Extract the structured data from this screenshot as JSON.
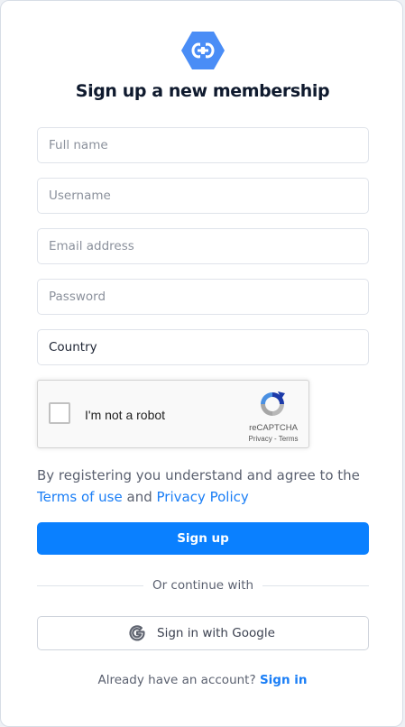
{
  "brand": {
    "logo_icon": "link-hexagon-icon",
    "logo_color": "#4a8df6"
  },
  "title": "Sign up a new membership",
  "fields": {
    "full_name": {
      "placeholder": "Full name",
      "value": ""
    },
    "username": {
      "placeholder": "Username",
      "value": ""
    },
    "email": {
      "placeholder": "Email address",
      "value": ""
    },
    "password": {
      "placeholder": "Password",
      "value": ""
    },
    "country": {
      "value": "Country"
    }
  },
  "recaptcha": {
    "label": "I'm not a robot",
    "brand": "reCAPTCHA",
    "links": "Privacy - Terms",
    "checked": false
  },
  "agreement": {
    "prefix": "By registering you understand and agree to the",
    "terms_link": "Terms of use",
    "conjunction": "and",
    "privacy_link": "Privacy Policy"
  },
  "signup_button": "Sign up",
  "divider_text": "Or continue with",
  "google_button": {
    "label": "Sign in with Google",
    "icon": "google-g-icon"
  },
  "footer": {
    "question": "Already have an account?",
    "signin_link": "Sign in"
  },
  "colors": {
    "primary": "#0a80ff",
    "link": "#1a7ef6",
    "title": "#0f1a2e",
    "muted_text": "#5b6170"
  }
}
